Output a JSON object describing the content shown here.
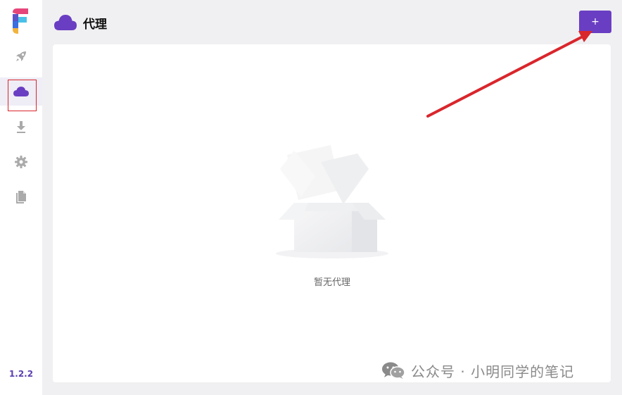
{
  "sidebar": {
    "items": [
      {
        "icon": "rocket-icon",
        "label": ""
      },
      {
        "icon": "cloud-icon",
        "label": "",
        "active": true
      },
      {
        "icon": "download-icon",
        "label": ""
      },
      {
        "icon": "gear-icon",
        "label": ""
      },
      {
        "icon": "document-icon",
        "label": ""
      }
    ],
    "version": "1.2.2"
  },
  "header": {
    "title": "代理",
    "icon": "cloud-icon"
  },
  "toolbar": {
    "add_label": "+"
  },
  "main": {
    "empty_text": "暂无代理",
    "empty_icon": "open-box-icon"
  },
  "watermark": {
    "text": "公众号 · 小明同学的笔记",
    "icon": "wechat-icon"
  },
  "colors": {
    "accent": "#6a3ec2",
    "highlight": "#d9262c",
    "background": "#f0f0f2"
  }
}
